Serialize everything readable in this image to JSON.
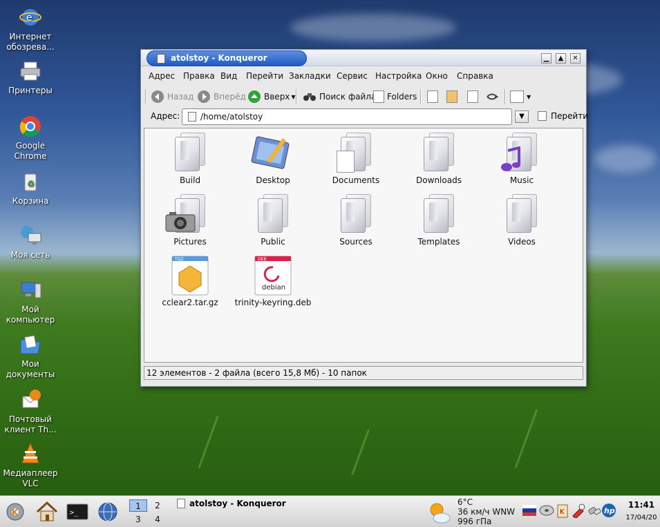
{
  "desktop": {
    "icons": [
      {
        "label": "Интернет обозрева..."
      },
      {
        "label": "Принтеры"
      },
      {
        "label": "Google Chrome"
      },
      {
        "label": "Корзина"
      },
      {
        "label": "Моя сеть"
      },
      {
        "label": "Мой компьютер"
      },
      {
        "label": "Мои документы"
      },
      {
        "label": "Почтовый клиент Th..."
      },
      {
        "label": "Медиаплеер VLC"
      }
    ]
  },
  "window": {
    "title": "atolstoy - Konqueror",
    "controls": {
      "minimize": "▁",
      "maximize": "▲",
      "close": "✕"
    },
    "menu": [
      "Адрес",
      "Правка",
      "Вид",
      "Перейти",
      "Закладки",
      "Сервис",
      "Настройка",
      "Окно",
      "Справка"
    ],
    "toolbar": {
      "back": "Назад",
      "forward": "Вперёд",
      "up": "Вверх",
      "find": "Поиск файла",
      "folders": "Folders"
    },
    "address": {
      "label": "Адрес:",
      "value": "/home/atolstoy",
      "go": "Перейти"
    },
    "files": [
      {
        "name": "Build",
        "type": "folder"
      },
      {
        "name": "Desktop",
        "type": "desktop"
      },
      {
        "name": "Documents",
        "type": "folder"
      },
      {
        "name": "Downloads",
        "type": "folder"
      },
      {
        "name": "Music",
        "type": "music"
      },
      {
        "name": "Pictures",
        "type": "pictures"
      },
      {
        "name": "Public",
        "type": "folder"
      },
      {
        "name": "Sources",
        "type": "folder"
      },
      {
        "name": "Templates",
        "type": "folder"
      },
      {
        "name": "Videos",
        "type": "folder"
      },
      {
        "name": "cclear2.tar.gz",
        "type": "archive",
        "badge": "TGZ"
      },
      {
        "name": "trinity-keyring.deb",
        "type": "deb",
        "badge": "DEB",
        "text": "debian"
      }
    ],
    "status": "12 элементов - 2 файла (всего 15,8 Мб) - 10 папок"
  },
  "taskbar": {
    "pager": [
      "1",
      "2",
      "3",
      "4"
    ],
    "active_desktop": "1",
    "task": "atolstoy - Konqueror",
    "weather": {
      "temp": "6°C",
      "wind": "36 км/ч WNW",
      "pressure": "996 гПа"
    },
    "clock": {
      "time": "11:41",
      "date": "17/04/20"
    }
  },
  "colors": {
    "title_pill": "#2a68d0",
    "desktop_sky": "#31589a",
    "desktop_grass": "#3e7a1e"
  }
}
